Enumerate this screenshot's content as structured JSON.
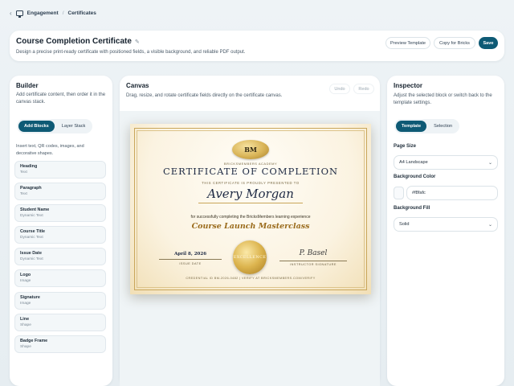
{
  "breadcrumb": {
    "section": "Engagement",
    "page": "Certificates"
  },
  "header": {
    "title": "Course Completion Certificate",
    "subtitle": "Design a precise print-ready certificate with positioned fields, a visible background, and reliable PDF output.",
    "preview_label": "Preview Template",
    "copy_label": "Copy for Bricks",
    "save_label": "Save"
  },
  "builder": {
    "title": "Builder",
    "subtitle": "Add certificate content, then order it in the canvas stack.",
    "tabs": [
      "Add Blocks",
      "Layer Stack"
    ],
    "active_tab": "Add Blocks",
    "hint": "Insert text, QR codes, images, and decorative shapes.",
    "blocks": [
      {
        "name": "Heading",
        "type": "Text"
      },
      {
        "name": "Paragraph",
        "type": "Text"
      },
      {
        "name": "Student Name",
        "type": "Dynamic Text"
      },
      {
        "name": "Course Title",
        "type": "Dynamic Text"
      },
      {
        "name": "Issue Date",
        "type": "Dynamic Text"
      },
      {
        "name": "Logo",
        "type": "Image"
      },
      {
        "name": "Signature",
        "type": "Image"
      },
      {
        "name": "Line",
        "type": "Shape"
      },
      {
        "name": "Badge Frame",
        "type": "Shape"
      }
    ]
  },
  "canvas": {
    "title": "Canvas",
    "subtitle": "Drag, resize, and rotate certificate fields directly on the certificate canvas.",
    "undo_label": "Undo",
    "redo_label": "Redo"
  },
  "certificate": {
    "logo_text": "BM",
    "academy": "BRICKSMEMBERS ACADEMY",
    "title": "CERTIFICATE OF COMPLETION",
    "presented": "THIS CERTIFICATE IS PROUDLY PRESENTED TO",
    "student": "Avery Morgan",
    "for_text": "for successfully completing the BricksMembers learning experience",
    "course": "Course Launch Masterclass",
    "date": "April 8, 2026",
    "date_label": "ISSUE DATE",
    "seal_text": "EXCELLENCE",
    "signature": "P. Basel",
    "signature_label": "INSTRUCTOR SIGNATURE",
    "credential": "CREDENTIAL ID BM-2026-0482 | VERIFY AT BRICKSMEMBERS.COM/VERIFY"
  },
  "inspector": {
    "title": "Inspector",
    "subtitle": "Adjust the selected block or switch back to the template settings.",
    "tabs": [
      "Template",
      "Selection"
    ],
    "active_tab": "Template",
    "page_size_label": "Page Size",
    "page_size": "A4 Landscape",
    "bg_color_label": "Background Color",
    "bg_color": "#f8fafc",
    "bg_fill_label": "Background Fill",
    "bg_fill": "Solid"
  },
  "colors": {
    "accent": "#0e5a75",
    "gold": "#c9a65a",
    "navy": "#1e2a44"
  }
}
